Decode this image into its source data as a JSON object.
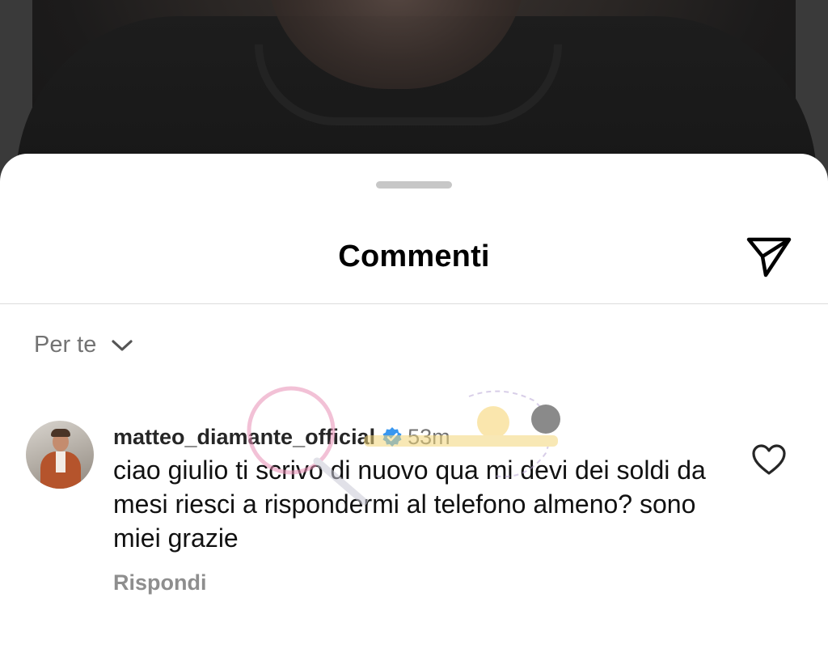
{
  "sheet": {
    "title": "Commenti",
    "share_icon": "paper-plane-icon"
  },
  "sort": {
    "label": "Per te",
    "chevron_icon": "chevron-down-icon"
  },
  "comment": {
    "username": "matteo_diamante_official",
    "verified_icon": "verified-badge-icon",
    "time": "53m",
    "text": "ciao giulio ti scrivo di nuovo qua mi devi dei soldi da mesi riesci a rispondermi al telefono almeno? sono miei grazie",
    "reply_label": "Rispondi",
    "like_icon": "heart-outline-icon"
  },
  "colors": {
    "verified_blue": "#3897f0",
    "secondary_text": "#737373",
    "watermark_pink": "#e98fb6"
  }
}
